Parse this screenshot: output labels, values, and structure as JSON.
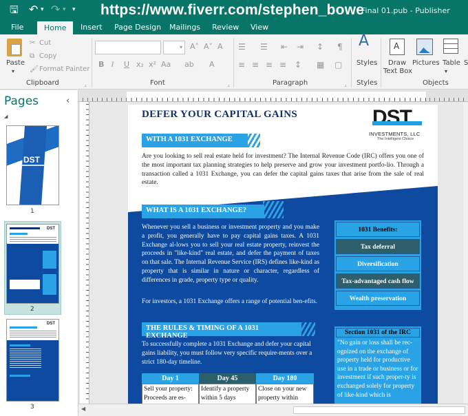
{
  "titlebar": {
    "save_glyph": "🖫",
    "undo_glyph": "↶",
    "redo_glyph": "↷",
    "more_glyph": "▾",
    "url": "https://www.fiverr.com/stephen_bowe",
    "doc_title": "Final 01.pub - Publisher"
  },
  "tabs": [
    {
      "label": "File"
    },
    {
      "label": "Home"
    },
    {
      "label": "Insert"
    },
    {
      "label": "Page Design"
    },
    {
      "label": "Mailings"
    },
    {
      "label": "Review"
    },
    {
      "label": "View"
    }
  ],
  "ribbon": {
    "clipboard": {
      "paste": "Paste",
      "cut": "Cut",
      "copy": "Copy",
      "format_painter": "Format Painter",
      "group": "Clipboard"
    },
    "font": {
      "group": "Font",
      "bold": "B",
      "italic": "I",
      "underline": "U",
      "sub": "x₂",
      "sup": "x²",
      "case": "Aa",
      "grow": "A˄",
      "shrink": "A˅",
      "clear": "A",
      "color": "A"
    },
    "paragraph": {
      "group": "Paragraph",
      "pilcrow": "¶"
    },
    "styles": {
      "label": "Styles",
      "group": "Styles"
    },
    "objects": {
      "draw_text_box": "Draw Text Box",
      "pictures": "Pictures",
      "table": "Table",
      "more": "S",
      "group": "Objects"
    }
  },
  "pages_panel": {
    "title": "Pages",
    "collapse": "‹",
    "pages": [
      {
        "num": "1"
      },
      {
        "num": "2"
      },
      {
        "num": "3"
      }
    ]
  },
  "document": {
    "title": "DEFER YOUR CAPITAL GAINS",
    "logo": {
      "text": "DST",
      "company": "INVESTMENTS, LLC",
      "tagline": "The Intelligent Choice"
    },
    "banner1": "WITH A 1031 EXCHANGE",
    "intro": "Are you looking to sell real estate held for investment? The Internal Revenue Code (IRC) offers you one of the most important tax planning strategies to help preserve and grow your investment portfo-lio. Through a transaction called a 1031 Exchange, you can defer the capital gains taxes that arise from the sale of real estate.",
    "banner2": "WHAT IS A 1031 EXCHANGE?",
    "what_para1": "Whenever you sell a business or investment property and you make a profit, you generally have to pay capital gains taxes. A 1031 Exchange al-lows you to sell your real estate property, reinvest the proceeds in \"like-kind\" real estate, and defer the payment of taxes on that sale. The Internal Revenue Service (IRS) defines like-kind as property that is similar in nature or character, regardless of differences in grade, property type or quality.",
    "what_para2": "For investors, a 1031 Exchange offers a range of potential ben-efits.",
    "benefits": {
      "title": "1031 Benefits:",
      "items": [
        "Tax deferral",
        "Diversification",
        "Tax-advantaged cash flow",
        "Wealth preservation"
      ]
    },
    "banner3": "THE RULES & TIMING OF A 1031 EXCHANGE",
    "rules_para": "To successfully complete a 1031 Exchange and defer your capital gains liability, you must follow very specific require-ments over a strict 180-day timeline.",
    "section": {
      "title": "Section 1031 of the IRC",
      "text": "\"No gain or loss shall be rec-ognized on the exchange of property held for productive use in a trade or business or for investment if such proper-ty is exchanged solely for property of like-kind which is"
    },
    "timeline": {
      "headers": [
        "Day 1",
        "Day 45",
        "Day 180"
      ],
      "cells": [
        "Sell your property: Proceeds are es-",
        "Identify a property within 5 days",
        "Close on your new property within"
      ]
    }
  },
  "colors": {
    "accent": "#077568",
    "banner": "#2aa3e6",
    "navy": "#0d4aa0",
    "dark_cell": "#2d5e6b"
  }
}
